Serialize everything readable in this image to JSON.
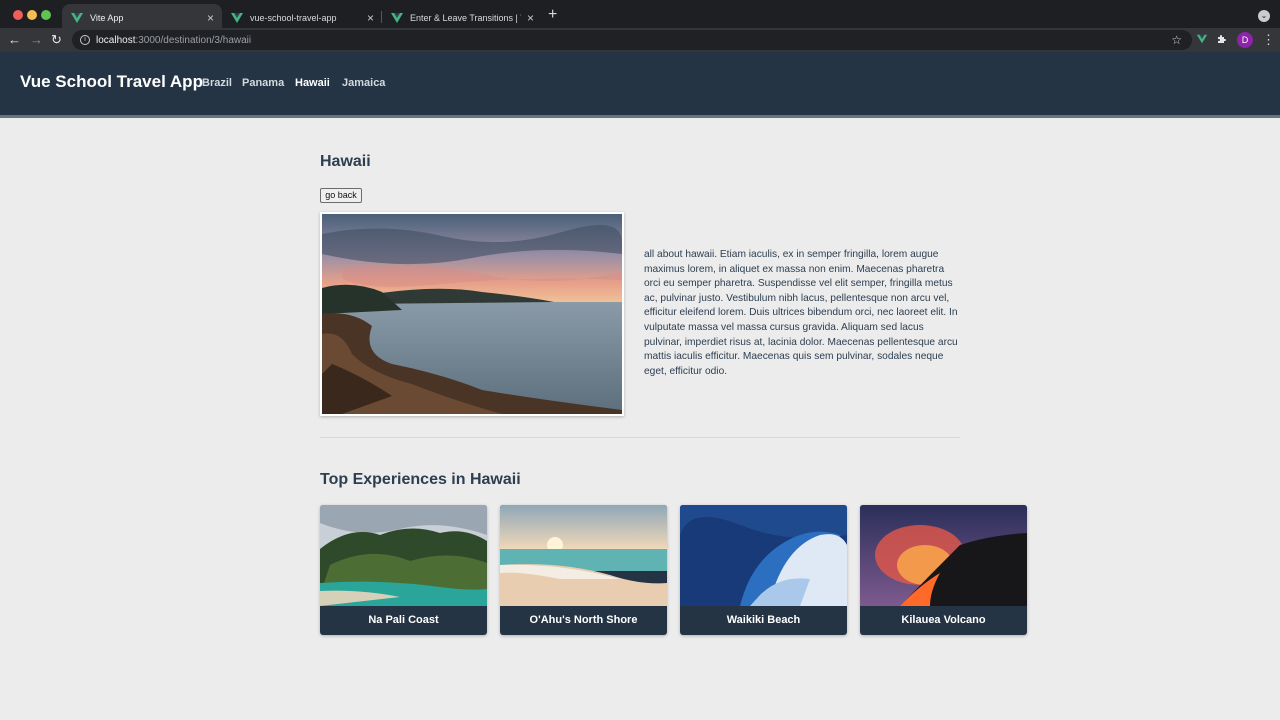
{
  "browser": {
    "tabs": [
      {
        "title": "Vite App",
        "close": "×"
      },
      {
        "title": "vue-school-travel-app",
        "close": "×"
      },
      {
        "title": "Enter & Leave Transitions | Vue",
        "close": "×"
      }
    ],
    "new_tab": "+",
    "address": {
      "host": "localhost",
      "path": ":3000/destination/3/hawaii"
    },
    "profile_initial": "D",
    "icons": {
      "back": "back-arrow-icon",
      "forward": "forward-arrow-icon",
      "reload": "reload-icon",
      "info": "info-icon",
      "bookmark": "star-icon",
      "vue_devtools": "vue-logo-icon",
      "extensions": "puzzle-icon",
      "menu": "kebab-menu-icon"
    }
  },
  "header": {
    "brand": "Vue School Travel App",
    "nav": [
      {
        "label": "Brazil",
        "active": false
      },
      {
        "label": "Panama",
        "active": false
      },
      {
        "label": "Hawaii",
        "active": true
      },
      {
        "label": "Jamaica",
        "active": false
      }
    ]
  },
  "destination": {
    "title": "Hawaii",
    "back_label": "go back",
    "description": "all about hawaii. Etiam iaculis, ex in semper fringilla, lorem augue maximus lorem, in aliquet ex massa non enim. Maecenas pharetra orci eu semper pharetra. Suspendisse vel elit semper, fringilla metus ac, pulvinar justo. Vestibulum nibh lacus, pellentesque non arcu vel, efficitur eleifend lorem. Duis ultrices bibendum orci, nec laoreet elit. In vulputate massa vel massa cursus gravida. Aliquam sed lacus pulvinar, imperdiet risus at, lacinia dolor. Maecenas pellentesque arcu mattis iaculis efficitur. Maecenas quis sem pulvinar, sodales neque eget, efficitur odio."
  },
  "experiences": {
    "title": "Top Experiences in Hawaii",
    "items": [
      {
        "name": "Na Pali Coast"
      },
      {
        "name": "O'Ahu's North Shore"
      },
      {
        "name": "Waikiki Beach"
      },
      {
        "name": "Kilauea Volcano"
      }
    ]
  },
  "colors": {
    "header": "#243444",
    "accent_vue": "#41b883",
    "text": "#2c3e50",
    "background": "#ececec"
  }
}
